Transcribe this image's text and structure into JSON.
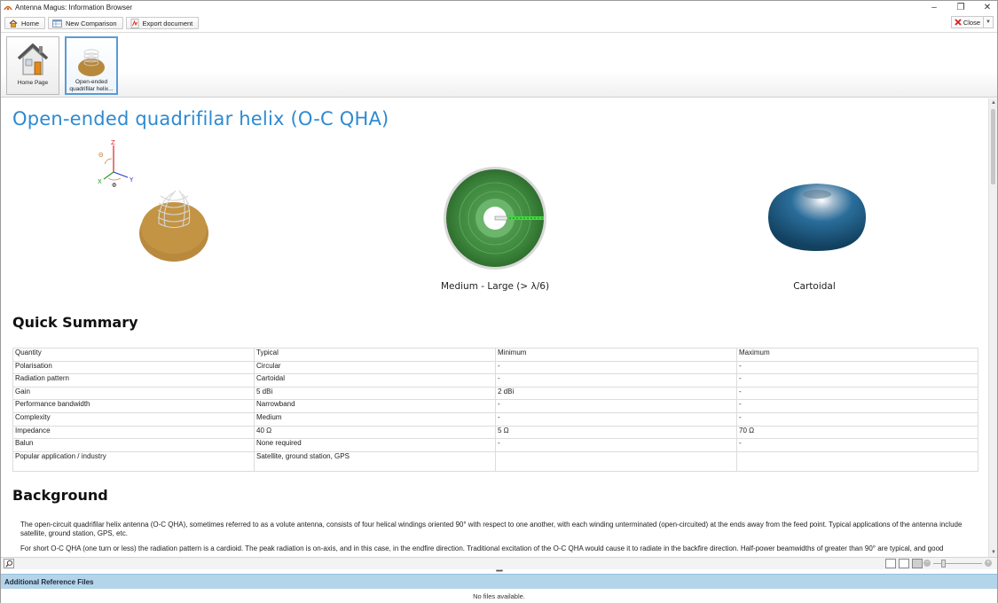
{
  "window": {
    "title": "Antenna Magus: Information Browser",
    "controls": {
      "minimize": "–",
      "restore": "❐",
      "close": "✕"
    }
  },
  "toolbar": {
    "home_label": "Home",
    "new_comparison_label": "New Comparison",
    "export_label": "Export document",
    "close_label": "Close"
  },
  "tabs": [
    {
      "label": "Home Page",
      "icon": "house-icon"
    },
    {
      "label": "Open-ended quadrifilar helix...",
      "icon": "helix-thumbnail-icon"
    }
  ],
  "page": {
    "title": "Open-ended quadrifilar helix (O-C QHA)",
    "figures": {
      "axis_labels": {
        "z": "Z",
        "theta": "Θ",
        "x": "X",
        "y": "Y",
        "phi": "Φ"
      },
      "size_caption": "Medium - Large (> λ/6)",
      "pattern_caption": "Cartoidal"
    },
    "summary_heading": "Quick Summary",
    "summary_table": {
      "headers": [
        "Quantity",
        "Typical",
        "Minimum",
        "Maximum"
      ],
      "rows": [
        [
          "Polarisation",
          "Circular",
          "-",
          "-"
        ],
        [
          "Radiation pattern",
          "Cartoidal",
          "-",
          "-"
        ],
        [
          "Gain",
          "5 dBi",
          "2 dBi",
          "-"
        ],
        [
          "Performance bandwidth",
          "Narrowband",
          "-",
          "-"
        ],
        [
          "Complexity",
          "Medium",
          "-",
          "-"
        ],
        [
          "Impedance",
          "40 Ω",
          "5 Ω",
          "70 Ω"
        ],
        [
          "Balun",
          "None required",
          "-",
          "-"
        ],
        [
          "Popular application / industry",
          "Satellite, ground station, GPS",
          "",
          ""
        ]
      ]
    },
    "background_heading": "Background",
    "background_paragraphs": [
      "The open-circuit quadrifilar helix antenna (O-C QHA), sometimes referred to as a volute antenna, consists of four helical windings oriented 90° with respect to one another, with each winding unterminated (open-circuited) at the ends away from the feed point. Typical applications of the antenna include satellite, ground station, GPS, etc.",
      "For short O-C QHA  (one turn or less) the radiation pattern is a cardioid. The peak radiation is on-axis, and in this case, in the endfire direction. Traditional excitation of the O-C QHA would cause it to radiate in the backfire direction. Half-power beamwidths of greater than 90° are typical, and good"
    ]
  },
  "reference_files": {
    "header": "Additional Reference Files",
    "empty_message": "No files available."
  },
  "colors": {
    "title_blue": "#2d8ad2",
    "reference_header_bg": "#b4d4ea",
    "active_tab_border": "#5a9bd5"
  }
}
